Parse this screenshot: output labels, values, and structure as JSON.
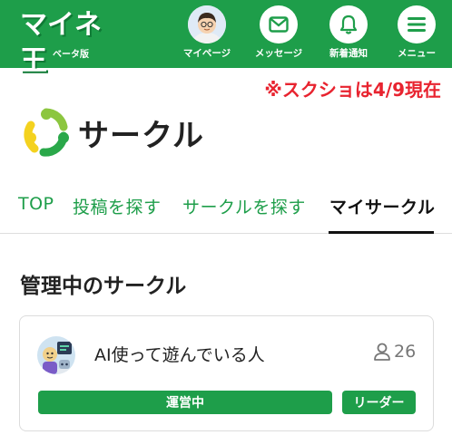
{
  "header": {
    "logo_text": "マイネ王",
    "logo_sub": "ベータ版",
    "nav": {
      "mypage": "マイページ",
      "message": "メッセージ",
      "notice": "新着通知",
      "menu": "メニュー"
    }
  },
  "note": "※スクショは4/9現在",
  "page": {
    "title": "サークル"
  },
  "tabs": {
    "top": "TOP",
    "search_posts": "投稿を探す",
    "search_circles": "サークルを探す",
    "my_circle": "マイサークル",
    "active": "my_circle"
  },
  "section": {
    "title": "管理中のサークル"
  },
  "circle": {
    "name": "AI使って遊んでいる人",
    "member_count": "26",
    "status_badge": "運営中",
    "role_badge": "リーダー"
  },
  "colors": {
    "brand_green": "#1e9e4a",
    "note_red": "#e8232f"
  },
  "icons": {
    "avatar": "user-avatar",
    "message": "envelope-icon",
    "notice": "bell-icon",
    "menu": "hamburger-icon",
    "members": "person-icon"
  }
}
